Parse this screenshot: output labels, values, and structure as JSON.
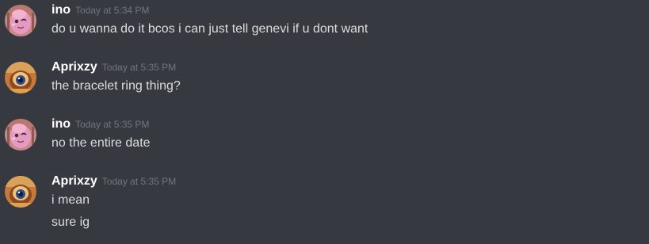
{
  "colors": {
    "background": "#36393f",
    "username": "#ffffff",
    "timestamp": "#72767d",
    "message_text": "#dcddde"
  },
  "messages": [
    {
      "author": "ino",
      "avatar_icon": "pink-character-avatar-icon",
      "timestamp": "Today at 5:34 PM",
      "lines": [
        "do u wanna do it bcos i can just tell genevi if u dont want"
      ]
    },
    {
      "author": "Aprixzy",
      "avatar_icon": "orange-character-avatar-icon",
      "timestamp": "Today at 5:35 PM",
      "lines": [
        "the bracelet ring thing?"
      ]
    },
    {
      "author": "ino",
      "avatar_icon": "pink-character-avatar-icon",
      "timestamp": "Today at 5:35 PM",
      "lines": [
        "no the entire date"
      ]
    },
    {
      "author": "Aprixzy",
      "avatar_icon": "orange-character-avatar-icon",
      "timestamp": "Today at 5:35 PM",
      "lines": [
        "i mean",
        "sure ig"
      ]
    }
  ]
}
